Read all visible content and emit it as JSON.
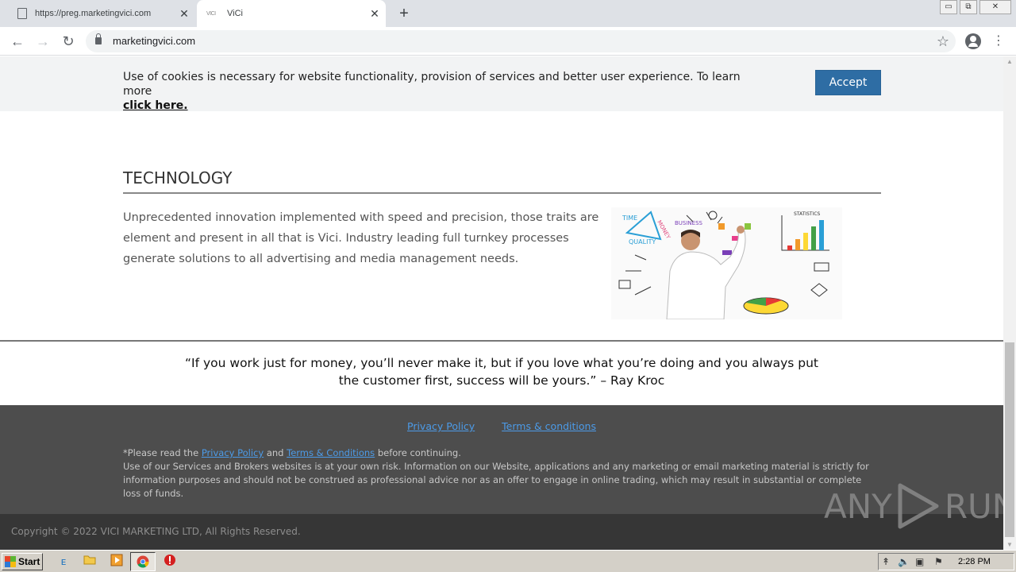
{
  "browser": {
    "tabs": [
      {
        "title": "https://preg.marketingvici.com",
        "close": "✕"
      },
      {
        "title": "ViCi",
        "close": "✕"
      }
    ],
    "new_tab": "+",
    "url": "marketingvici.com",
    "window_controls": {
      "minimize": "▭",
      "restore": "⧉",
      "close": "✕"
    }
  },
  "cookie_banner": {
    "text": "Use of cookies is necessary for website functionality, provision of services and better user experience. To learn more",
    "link": "click here.",
    "accept": "Accept"
  },
  "section": {
    "title": "TECHNOLOGY",
    "body": "Unprecedented innovation implemented with speed and precision, those traits are element and present in all that is Vici. Industry leading full turnkey processes generate solutions to all advertising and media management needs."
  },
  "quote": {
    "text": "“If you work just for money, you’ll never make it, but if you love what you’re doing and you always put the customer first, success will be yours.” – Ray Kroc"
  },
  "footer": {
    "privacy_link": "Privacy Policy",
    "terms_link": "Terms & conditions",
    "note_prefix": "*Please read the",
    "note_privacy": "Privacy Policy",
    "note_and": "and",
    "note_terms": "Terms & Conditions",
    "note_suffix": "before continuing.",
    "disclaimer": "Use of our Services and Brokers websites is at your own risk. Information on our Website, applications and any marketing or email marketing material is strictly for information purposes and should not be construed as professional advice nor as an offer to engage in online trading, which may result in substantial or complete loss of funds.",
    "copyright": "Copyright © 2022 VICI MARKETING LTD, All Rights Reserved."
  },
  "watermark": {
    "left": "ANY",
    "right": "RUN"
  },
  "image_text": {
    "time": "TIME",
    "quality": "QUALITY",
    "money": "MONEY",
    "business": "BUSINESS",
    "statistics": "STATISTICS"
  },
  "taskbar": {
    "start": "Start",
    "clock": "2:28 PM"
  },
  "colors": {
    "accept": "#2e6da4",
    "link": "#4c9be8",
    "footer": "#4d4d4d"
  }
}
